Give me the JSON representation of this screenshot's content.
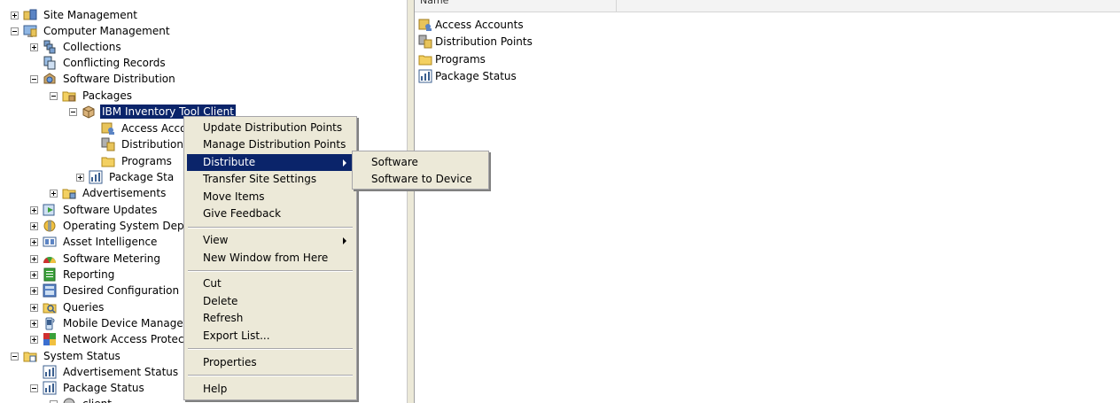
{
  "tree": {
    "items": [
      {
        "label": "Site Management",
        "icon": "site-management-icon"
      },
      {
        "label": "Computer Management",
        "icon": "computer-management-icon"
      },
      {
        "label": "Collections",
        "icon": "collections-icon"
      },
      {
        "label": "Conflicting Records",
        "icon": "conflicting-records-icon"
      },
      {
        "label": "Software Distribution",
        "icon": "software-distribution-icon"
      },
      {
        "label": "Packages",
        "icon": "packages-folder-icon"
      },
      {
        "label": "IBM Inventory Tool Client",
        "icon": "package-icon"
      },
      {
        "label": "Access Acco",
        "icon": "access-accounts-icon"
      },
      {
        "label": "Distribution I",
        "icon": "distribution-points-icon"
      },
      {
        "label": "Programs",
        "icon": "folder-icon"
      },
      {
        "label": "Package Sta",
        "icon": "package-status-icon"
      },
      {
        "label": "Advertisements",
        "icon": "advertisements-icon"
      },
      {
        "label": "Software Updates",
        "icon": "software-updates-icon"
      },
      {
        "label": "Operating System Deplo",
        "icon": "os-deployment-icon"
      },
      {
        "label": "Asset Intelligence",
        "icon": "asset-intelligence-icon"
      },
      {
        "label": "Software Metering",
        "icon": "software-metering-icon"
      },
      {
        "label": "Reporting",
        "icon": "reporting-icon"
      },
      {
        "label": "Desired Configuration M",
        "icon": "desired-configuration-icon"
      },
      {
        "label": "Queries",
        "icon": "queries-icon"
      },
      {
        "label": "Mobile Device Managem",
        "icon": "mobile-device-icon"
      },
      {
        "label": "Network Access Protecti",
        "icon": "network-access-icon"
      },
      {
        "label": "System Status",
        "icon": "system-status-icon"
      },
      {
        "label": "Advertisement Status",
        "icon": "advertisement-status-icon"
      },
      {
        "label": "Package Status",
        "icon": "package-status-icon"
      },
      {
        "label": "client",
        "icon": "client-icon"
      }
    ]
  },
  "list": {
    "column_name": "Name",
    "items": [
      {
        "label": "Access Accounts",
        "icon": "access-accounts-icon"
      },
      {
        "label": "Distribution Points",
        "icon": "distribution-points-icon"
      },
      {
        "label": "Programs",
        "icon": "folder-icon"
      },
      {
        "label": "Package Status",
        "icon": "package-status-icon"
      }
    ]
  },
  "context_menu": {
    "items": [
      "Update Distribution Points",
      "Manage Distribution Points",
      "Distribute",
      "Transfer Site Settings",
      "Move Items",
      "Give Feedback",
      "View",
      "New Window from Here",
      "Cut",
      "Delete",
      "Refresh",
      "Export List...",
      "Properties",
      "Help"
    ]
  },
  "submenu": {
    "items": [
      "Software",
      "Software to Device"
    ]
  },
  "colors": {
    "selection": "#0a246a",
    "menu_bg": "#ece9d8"
  }
}
